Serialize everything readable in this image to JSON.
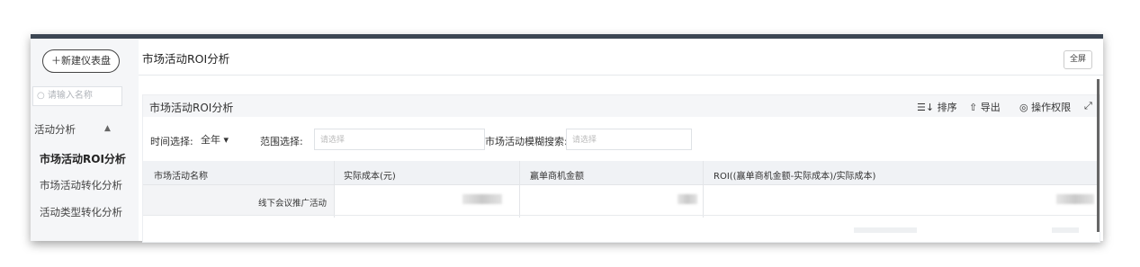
{
  "sidebar": {
    "new_button": "＋新建仪表盘",
    "search_placeholder": "○ 请输入名称",
    "group_label": "活动分析",
    "group_caret": "▲",
    "items": [
      {
        "label": "市场活动ROI分析",
        "active": true
      },
      {
        "label": "市场活动转化分析",
        "active": false
      },
      {
        "label": "活动类型转化分析",
        "active": false
      }
    ]
  },
  "header": {
    "title": "市场活动ROI分析",
    "fullscreen_label": "全屏"
  },
  "panel": {
    "title": "市场活动ROI分析",
    "tools": {
      "sort": "☰↓ 排序",
      "export": "⇧ 导出",
      "permission": "◎ 操作权限",
      "expand": "⤢"
    },
    "filters": {
      "time_label": "时间选择:",
      "time_value": "全年 ▾",
      "range_label": "范围选择:",
      "range_placeholder": "请选择",
      "search_label": "市场活动模糊搜索:",
      "search_placeholder": "请选择"
    },
    "table": {
      "columns": [
        "市场活动名称",
        "实际成本(元)",
        "赢单商机金额",
        "ROI((赢单商机金额-实际成本)/实际成本)"
      ],
      "rows": [
        {
          "name": "线下会议推广活动"
        }
      ]
    }
  },
  "colors": {
    "topbar": "#3c4653",
    "sidebar_bg": "#f5f6f8",
    "header_row_bg": "#f0f2f5"
  }
}
